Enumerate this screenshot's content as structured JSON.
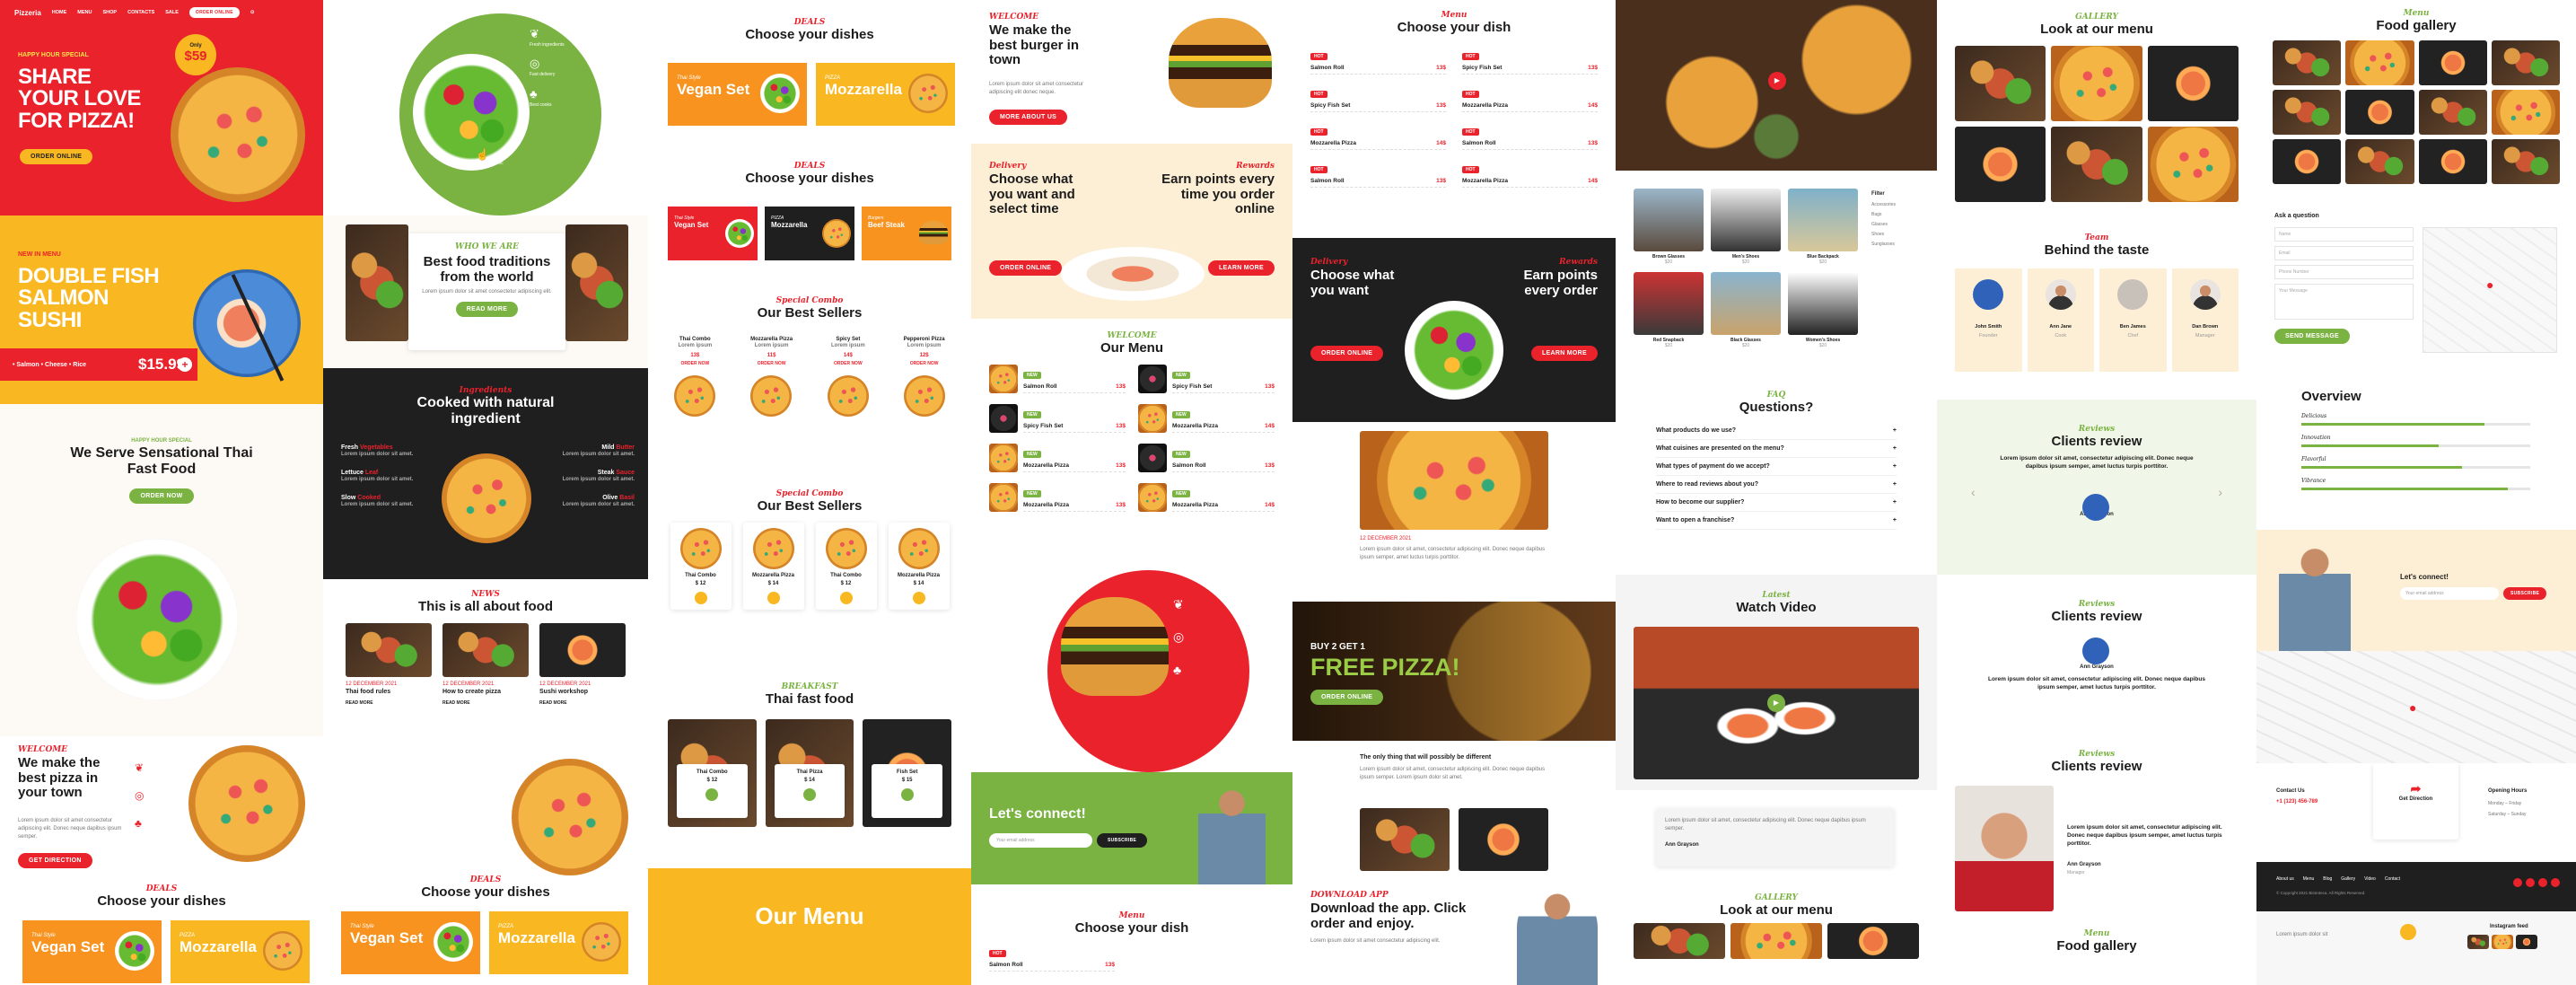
{
  "brand": {
    "logo": "Pizzeria"
  },
  "colors": {
    "red": "#e9222c",
    "yellow": "#f9b821",
    "green": "#7ab342",
    "dark": "#1f1f1f",
    "cream": "#fdefd6"
  },
  "col1": {
    "nav": [
      "HOME",
      "MENU",
      "SHOP",
      "CONTACTS",
      "SALE"
    ],
    "nav_button": "ORDER ONLINE",
    "hero1": {
      "tag": "HAPPY HOUR SPECIAL",
      "title_l1": "SHARE",
      "title_l2": "YOUR LOVE",
      "title_l3": "FOR PIZZA!",
      "price_top": "Only",
      "price": "$59",
      "button": "ORDER ONLINE"
    },
    "hero2": {
      "tag": "NEW IN MENU",
      "title_l1": "DOUBLE FISH",
      "title_l2": "SALMON",
      "title_l3": "SUSHI",
      "ingredients": "• Salmon  • Cheese  • Rice",
      "price": "$15.99"
    },
    "thai": {
      "tag": "HAPPY HOUR SPECIAL",
      "title": "We Serve Sensational Thai Fast Food",
      "button": "ORDER NOW"
    },
    "welcome": {
      "tag": "WELCOME",
      "title": "We make the best pizza in your town",
      "button": "GET DIRECTION"
    },
    "dishes": {
      "tag": "DEALS",
      "title": "Choose your dishes",
      "card1": {
        "small": "Thai Style",
        "name": "Vegan Set"
      },
      "card2": {
        "small": "PIZZA",
        "name": "Mozzarella"
      }
    }
  },
  "col2": {
    "traditions": {
      "tag": "WHO WE ARE",
      "title": "Best food traditions from the world",
      "button": "READ MORE"
    },
    "natural": {
      "tag": "Ingredients",
      "title": "Cooked with natural ingredient",
      "left": [
        {
          "a": "Fresh",
          "b": "Vegetables"
        },
        {
          "a": "Lettuce",
          "b": "Leaf"
        },
        {
          "a": "Slow",
          "b": "Cooked"
        }
      ],
      "right": [
        {
          "a": "Mild",
          "b": "Butter"
        },
        {
          "a": "Steak",
          "b": "Sauce"
        },
        {
          "a": "Olive",
          "b": "Basil"
        }
      ]
    },
    "about": {
      "tag": "NEWS",
      "title": "This is all about food",
      "posts": [
        {
          "meta": "12 DECEMBER 2021",
          "title": "Thai food rules",
          "more": "READ MORE"
        },
        {
          "meta": "12 DECEMBER 2021",
          "title": "How to create pizza",
          "more": "READ MORE"
        },
        {
          "meta": "12 DECEMBER 2021",
          "title": "Sushi workshop",
          "more": "READ MORE"
        }
      ]
    },
    "round": {
      "items": [
        "Fresh ingredients",
        "Fast delivery",
        "Best cooks",
        "100% organic"
      ]
    }
  },
  "col3": {
    "dishes1": {
      "tag": "DEALS",
      "title": "Choose your dishes",
      "c1_small": "Thai Style",
      "c1": "Vegan Set",
      "c2_small": "PIZZA",
      "c2": "Mozzarella"
    },
    "dishes2": {
      "tag": "DEALS",
      "title": "Choose your dishes",
      "cards": [
        {
          "small": "Thai Style",
          "name": "Vegan Set"
        },
        {
          "small": "PIZZA",
          "name": "Mozzarella"
        },
        {
          "small": "Burgers",
          "name": "Beef Steak"
        }
      ]
    },
    "sellers1": {
      "tag": "Special Combo",
      "title": "Our Best Sellers",
      "items": [
        {
          "name": "Thai Combo",
          "price": "13$"
        },
        {
          "name": "Mozzarella Pizza",
          "price": "11$"
        },
        {
          "name": "Spicy Set",
          "price": "14$"
        },
        {
          "name": "Pepperoni Pizza",
          "price": "12$"
        }
      ],
      "link": "ORDER NOW"
    },
    "sellers2": {
      "tag": "Special Combo",
      "title": "Our Best Sellers",
      "items": [
        {
          "name": "Thai Combo",
          "price": "$ 12"
        },
        {
          "name": "Mozzarella Pizza",
          "price": "$ 14"
        },
        {
          "name": "Thai Combo",
          "price": "$ 12"
        },
        {
          "name": "Mozzarella Pizza",
          "price": "$ 14"
        }
      ]
    },
    "thai": {
      "tag": "BREAKFAST",
      "title": "Thai fast food",
      "items": [
        {
          "name": "Thai Combo",
          "price": "$ 12"
        },
        {
          "name": "Thai Pizza",
          "price": "$ 14"
        },
        {
          "name": "Fish Set",
          "price": "$ 15"
        }
      ]
    },
    "our_menu": "Our Menu"
  },
  "col4": {
    "welcome": {
      "tag": "WELCOME",
      "title": "We make the best burger in town",
      "button": "MORE ABOUT US"
    },
    "delivery": {
      "tag_l": "Delivery",
      "title_l": "Choose what you want and select time",
      "button_l": "ORDER ONLINE",
      "tag_r": "Rewards",
      "title_r": "Earn points every time you order online",
      "button_r": "LEARN MORE"
    },
    "menu": {
      "tag": "WELCOME",
      "title": "Our Menu",
      "rows": [
        {
          "name": "Salmon Roll",
          "price": "13$"
        },
        {
          "name": "Spicy Fish Set",
          "price": "13$"
        },
        {
          "name": "Mozzarella Pizza",
          "price": "13$"
        },
        {
          "name": "Mozzarella Pizza",
          "price": "13$"
        }
      ],
      "rows_r": [
        {
          "name": "Spicy Fish Set",
          "price": "13$"
        },
        {
          "name": "Mozzarella Pizza",
          "price": "14$"
        },
        {
          "name": "Salmon Roll",
          "price": "13$"
        },
        {
          "name": "Mozzarella Pizza",
          "price": "14$"
        }
      ]
    },
    "connect": {
      "title": "Let's connect!",
      "placeholder": "Your email address",
      "button": "SUBSCRIBE"
    },
    "our_menu": "Our Menu",
    "dish": {
      "tag": "Menu",
      "title": "Choose your dish",
      "rows": [
        {
          "name": "Salmon Roll",
          "price": "13$"
        },
        {
          "name": "Spicy Fish Set",
          "price": "13$"
        }
      ]
    }
  },
  "col5": {
    "dish": {
      "tag": "Menu",
      "title": "Choose your dish",
      "left": [
        {
          "name": "Salmon Roll",
          "price": "13$"
        },
        {
          "name": "Spicy Fish Set",
          "price": "13$"
        },
        {
          "name": "Mozzarella Pizza",
          "price": "14$"
        },
        {
          "name": "Salmon Roll",
          "price": "13$"
        }
      ],
      "right": [
        {
          "name": "Spicy Fish Set",
          "price": "13$"
        },
        {
          "name": "Mozzarella Pizza",
          "price": "14$"
        },
        {
          "name": "Salmon Roll",
          "price": "13$"
        },
        {
          "name": "Mozzarella Pizza",
          "price": "14$"
        }
      ]
    },
    "dark": {
      "tag_l": "Delivery",
      "title_l": "Choose what you want",
      "button_l": "ORDER ONLINE",
      "tag_r": "Rewards",
      "title_r": "Earn points every order",
      "button_r": "LEARN MORE"
    },
    "blog_meta": "12 DECEMBER 2021",
    "free": {
      "top": "BUY 2 GET 1",
      "title": "FREE PIZZA!",
      "button": "ORDER ONLINE"
    },
    "best": {
      "title": "The only thing that will possibly be different"
    },
    "app": {
      "tag": "DOWNLOAD APP",
      "title": "Download the app. Click order and enjoy."
    }
  },
  "col6": {
    "shop": {
      "items": [
        {
          "name": "Brown Glasses",
          "price": "$20"
        },
        {
          "name": "Men's Shoes",
          "price": "$20"
        },
        {
          "name": "Blue Backpack",
          "price": "$20"
        },
        {
          "name": "Red Snapback",
          "price": "$20"
        },
        {
          "name": "Black Glasses",
          "price": "$20"
        },
        {
          "name": "Women's Shoes",
          "price": "$20"
        }
      ],
      "filter": "Filter",
      "cats": [
        "Accessories",
        "Bags",
        "Glasses",
        "Shoes",
        "Sunglasses"
      ]
    },
    "faq": {
      "tag": "FAQ",
      "title": "Questions?",
      "q": [
        "What products do we use?",
        "What cuisines are presented on the menu?",
        "What types of payment do we accept?",
        "Where to read reviews about you?",
        "How to become our supplier?",
        "Want to open a franchise?"
      ]
    },
    "video": {
      "tag": "Latest",
      "title": "Watch Video"
    },
    "review_name": "Ann Grayson",
    "menu": {
      "tag": "GALLERY",
      "title": "Look at our menu"
    }
  },
  "col7": {
    "menu": {
      "tag": "GALLERY",
      "title": "Look at our menu"
    },
    "team": {
      "tag": "Team",
      "title": "Behind the taste",
      "people": [
        {
          "name": "John Smith",
          "role": "Founder"
        },
        {
          "name": "Ann Jane",
          "role": "Cook"
        },
        {
          "name": "Ben James",
          "role": "Chef"
        },
        {
          "name": "Dan Brown",
          "role": "Manager"
        }
      ]
    },
    "reviews": {
      "tag": "Reviews",
      "title": "Clients review",
      "quote": "Lorem ipsum dolor sit amet, consectetur adipiscing elit. Donec neque dapibus ipsum semper, amet luctus turpis porttitor.",
      "name": "Ann Grayson",
      "role": "Manager"
    },
    "gallery": {
      "tag": "Menu",
      "title": "Food gallery"
    }
  },
  "col8": {
    "gallery": {
      "tag": "Menu",
      "title": "Food gallery"
    },
    "ask": {
      "title": "Ask a question",
      "fields": [
        "Name",
        "Email",
        "Phone Number",
        "Your Message"
      ],
      "button": "SEND MESSAGE"
    },
    "overview": {
      "title": "Overview",
      "bars": [
        {
          "label": "Delicious",
          "value": 0.8
        },
        {
          "label": "Innovation",
          "value": 0.6
        },
        {
          "label": "Flavorful",
          "value": 0.7
        },
        {
          "label": "Vibrance",
          "value": 0.9
        }
      ]
    },
    "connect": {
      "title": "Let's connect!",
      "placeholder": "Your email address",
      "button": "SUBSCRIBE"
    },
    "contact": {
      "title": "Contact Us",
      "phone": "+1 (123) 456-789",
      "direction": "Get Direction",
      "hours_title": "Opening Hours",
      "hours": [
        "Monday – Friday",
        "Saturday – Sunday"
      ]
    },
    "footer_nav": [
      "About us",
      "Menu",
      "Blog",
      "Gallery",
      "Video",
      "Contact"
    ],
    "copyright": "© Copyright 2021 Bistroteca. All Rights Reserved.",
    "instagram": "Instagram feed"
  }
}
